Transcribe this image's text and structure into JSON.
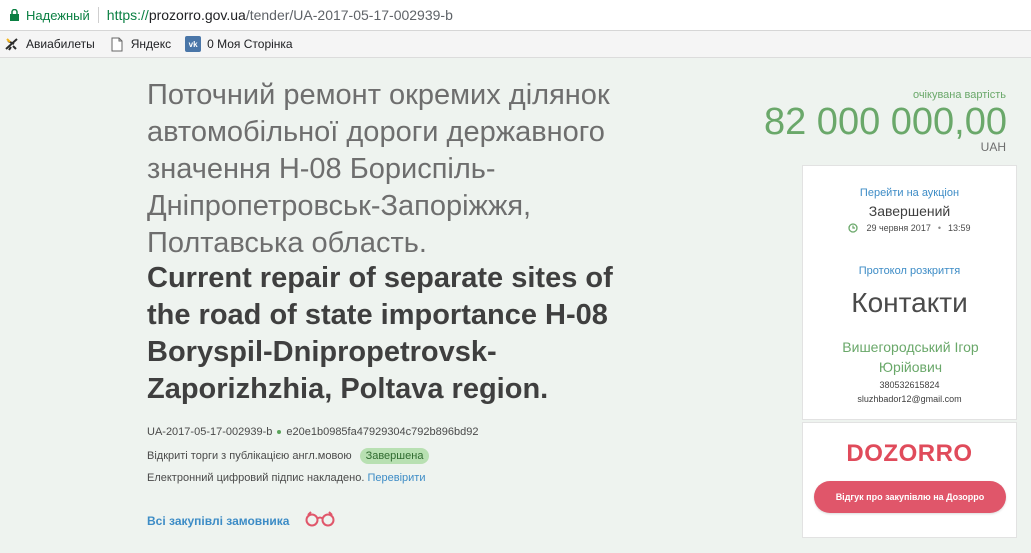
{
  "browser": {
    "secure_label": "Надежный",
    "url_scheme": "https://",
    "url_host": "prozorro.gov.ua",
    "url_path": "/tender/UA-2017-05-17-002939-b"
  },
  "bookmarks": [
    {
      "label": "Авиабилеты",
      "icon": "airplane-icon"
    },
    {
      "label": "Яндекс",
      "icon": "page-icon"
    },
    {
      "label": "0 Моя Сторінка",
      "icon": "vk-icon"
    }
  ],
  "vk_icon_text": "vk",
  "tender": {
    "title_ua": "Поточний ремонт окремих ділянок автомобільної дороги державного значення Н-08 Бориспіль-Дніпропетровськ-Запоріжжя, Полтавська область.",
    "title_en": "Current repair of separate sites of the road of state importance H-08 Boryspil-Dnipropetrovsk-Zaporizhzhia, Poltava region.",
    "id": "UA-2017-05-17-002939-b",
    "hash": "e20e1b0985fa47929304c792b896bd92",
    "procedure": "Відкриті торги з публікацією англ.мовою",
    "status_badge": "Завершена",
    "signature_text": "Електронний цифровий підпис накладено.",
    "signature_link": "Перевірити",
    "buyer_link": "Всі закупівлі замовника"
  },
  "value": {
    "label": "очікувана вартість",
    "amount": "82 000 000,00",
    "currency": "UAH"
  },
  "auction": {
    "link": "Перейти на аукціон",
    "status": "Завершений",
    "date": "29 червня 2017",
    "time": "13:59"
  },
  "protocol_link": "Протокол розкриття",
  "contacts": {
    "title": "Контакти",
    "name": "Вишегородський Ігор Юрійович",
    "phone": "380532615824",
    "email": "sluzhbador12@gmail.com"
  },
  "dozorro": {
    "logo": "DOZORRO",
    "button": "Відгук про закупівлю на Дозорро"
  },
  "colors": {
    "accent_green": "#6aa86a",
    "link_blue": "#3d8cc6",
    "dozorro_red": "#e0566a",
    "secure_green": "#0b8043"
  }
}
